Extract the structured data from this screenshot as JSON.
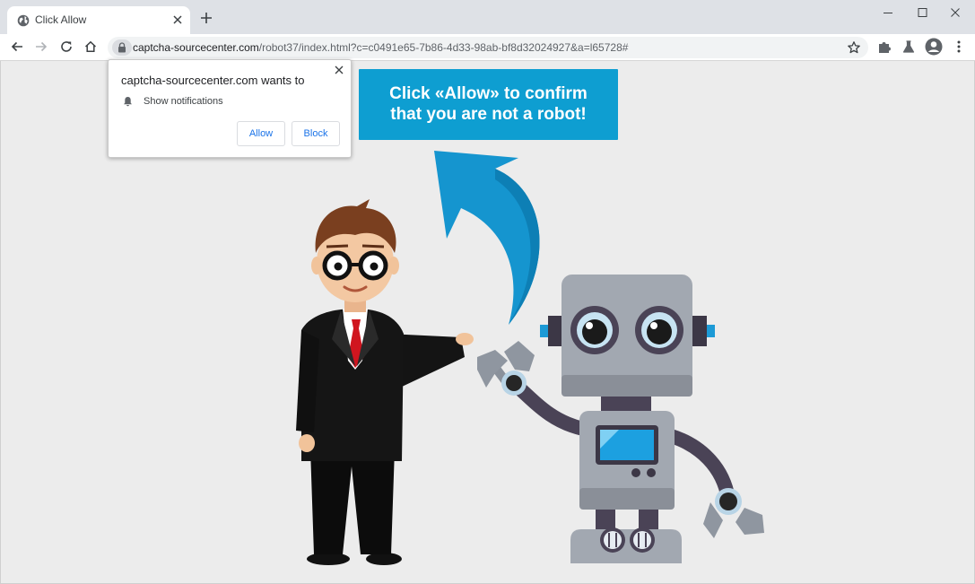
{
  "tab": {
    "title": "Click Allow"
  },
  "address_bar": {
    "host": "captcha-sourcecenter.com",
    "path": "/robot37/index.html?c=c0491e65-7b86-4d33-98ab-bf8d32024927&a=l65728#"
  },
  "notification_prompt": {
    "title": "captcha-sourcecenter.com wants to",
    "permission": "Show notifications",
    "allow_label": "Allow",
    "block_label": "Block"
  },
  "banner": {
    "line1": "Click «Allow» to confirm",
    "line2": "that you are not a robot!"
  },
  "colors": {
    "banner": "#0e9ed1",
    "arrow": "#1595cf",
    "robot_body": "#a2a8b1",
    "robot_dark": "#4a4356",
    "suit": "#111111",
    "tie": "#d0151f"
  }
}
